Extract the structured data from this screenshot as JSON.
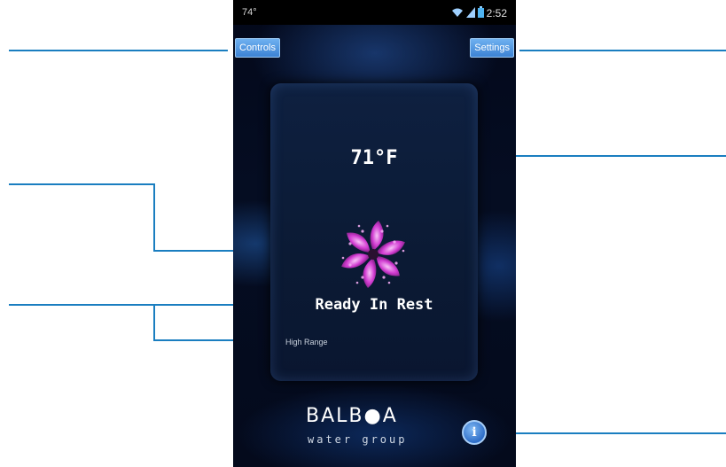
{
  "status_bar": {
    "temperature": "74°",
    "time": "2:52",
    "icons": [
      "wifi-icon",
      "signal-icon",
      "battery-icon"
    ]
  },
  "header": {
    "controls_label": "Controls",
    "settings_label": "Settings"
  },
  "main": {
    "set_temperature": "71°F",
    "status_message": "Ready In Rest",
    "temperature_range": "High Range"
  },
  "brand": {
    "name": "BALB●A",
    "tagline": "water group"
  },
  "info_button": {
    "icon": "info-icon",
    "glyph": "i"
  },
  "colors": {
    "leader_line": "#1a7ec0",
    "button_blue": "#3c82d4",
    "logo_magenta": "#d23cd2"
  }
}
